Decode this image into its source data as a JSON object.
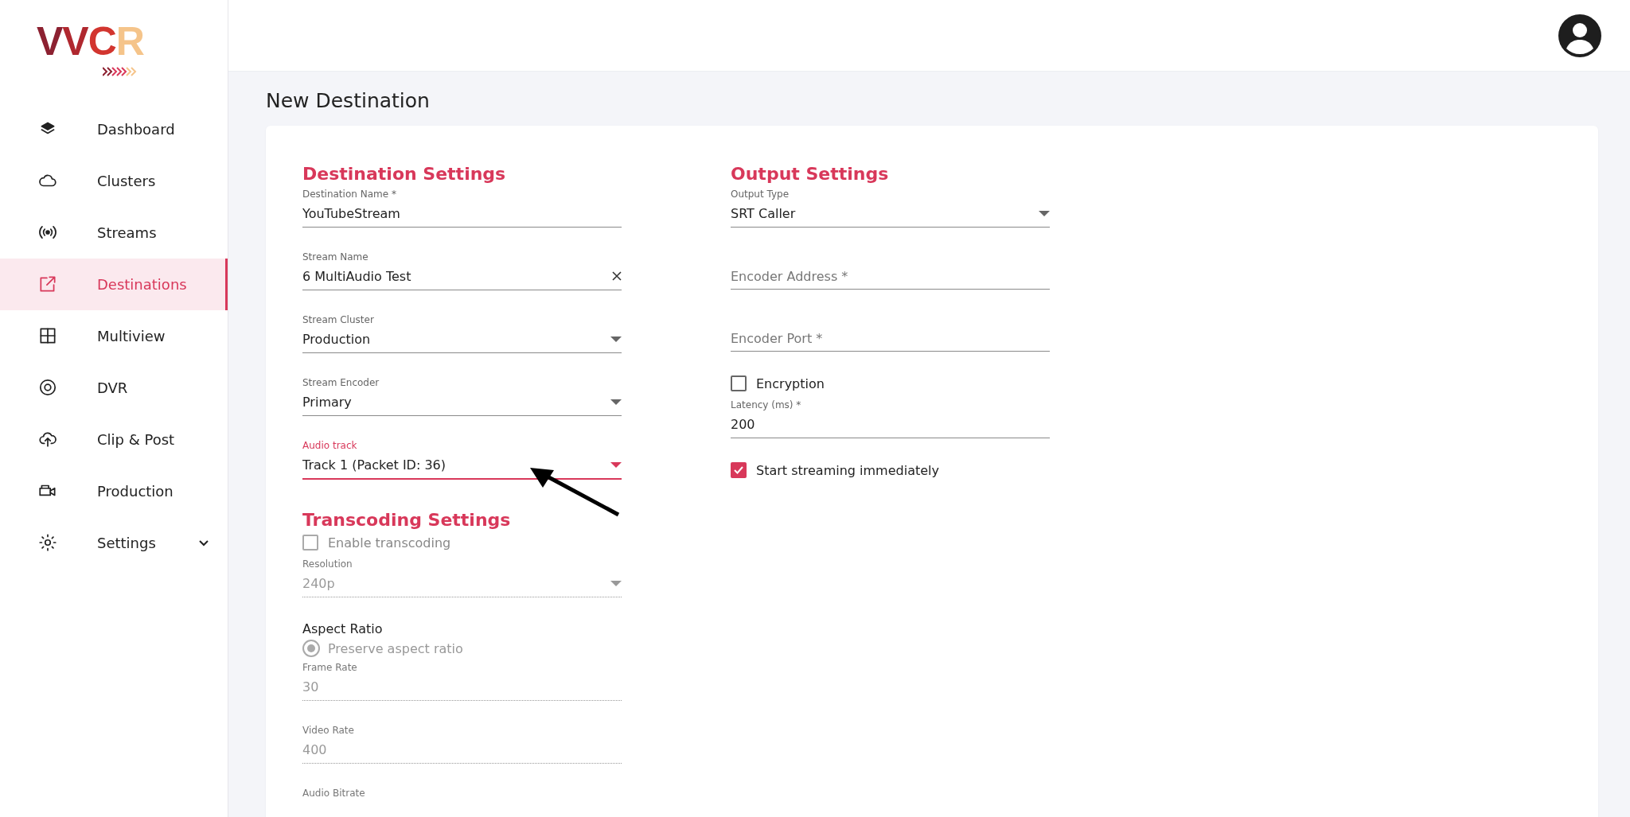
{
  "logo": {
    "text": "VVCR"
  },
  "sidebar": {
    "items": [
      {
        "label": "Dashboard",
        "selected": false
      },
      {
        "label": "Clusters",
        "selected": false
      },
      {
        "label": "Streams",
        "selected": false
      },
      {
        "label": "Destinations",
        "selected": true
      },
      {
        "label": "Multiview",
        "selected": false
      },
      {
        "label": "DVR",
        "selected": false
      },
      {
        "label": "Clip & Post",
        "selected": false
      },
      {
        "label": "Production",
        "selected": false
      },
      {
        "label": "Settings",
        "selected": false,
        "expanded": false
      }
    ]
  },
  "page": {
    "title": "New Destination"
  },
  "form": {
    "columns": [
      {
        "items": [
          {
            "kind": "heading",
            "text": "Destination Settings"
          },
          {
            "kind": "text",
            "label": "Destination Name *",
            "value": "YouTubeStream",
            "disabled": false,
            "focused": false
          },
          {
            "kind": "text",
            "label": "Stream Name",
            "value": "6 MultiAudio Test",
            "clearable": true,
            "disabled": false,
            "focused": false
          },
          {
            "kind": "select",
            "label": "Stream Cluster",
            "value": "Production",
            "disabled": false,
            "focused": false
          },
          {
            "kind": "select",
            "label": "Stream Encoder",
            "value": "Primary",
            "disabled": false,
            "focused": false
          },
          {
            "kind": "select",
            "label": "Audio track",
            "value": "Track 1 (Packet ID: 36)",
            "disabled": false,
            "focused": true
          },
          {
            "kind": "heading",
            "text": "Transcoding Settings"
          },
          {
            "kind": "checkbox",
            "label": "Enable transcoding",
            "checked": false,
            "disabled": true
          },
          {
            "kind": "select",
            "label": "Resolution",
            "value": "240p",
            "disabled": true,
            "focused": false
          },
          {
            "kind": "radio",
            "label": "Aspect Ratio",
            "options": [
              {
                "label": "Preserve aspect ratio",
                "selected": true,
                "disabled": true
              }
            ]
          },
          {
            "kind": "text",
            "label": "Frame Rate",
            "value": "30",
            "disabled": true,
            "focused": false
          },
          {
            "kind": "text",
            "label": "Video Rate",
            "value": "400",
            "disabled": true,
            "focused": false
          },
          {
            "kind": "text",
            "label": "Audio Bitrate",
            "disabled": true,
            "focused": false
          }
        ]
      },
      {
        "items": [
          {
            "kind": "heading",
            "text": "Output Settings"
          },
          {
            "kind": "select",
            "label": "Output Type",
            "value": "SRT Caller",
            "disabled": false,
            "focused": false
          },
          {
            "kind": "empty",
            "placeholder": "Encoder Address *",
            "disabled": false,
            "focused": false
          },
          {
            "kind": "empty",
            "placeholder": "Encoder Port *",
            "disabled": false,
            "focused": false
          },
          {
            "kind": "checkbox",
            "label": "Encryption",
            "checked": false,
            "disabled": false
          },
          {
            "kind": "text",
            "label": "Latency (ms) *",
            "value": "200",
            "disabled": false,
            "focused": false
          },
          {
            "kind": "checkbox",
            "label": "Start streaming immediately",
            "checked": true,
            "disabled": false
          }
        ]
      }
    ]
  }
}
